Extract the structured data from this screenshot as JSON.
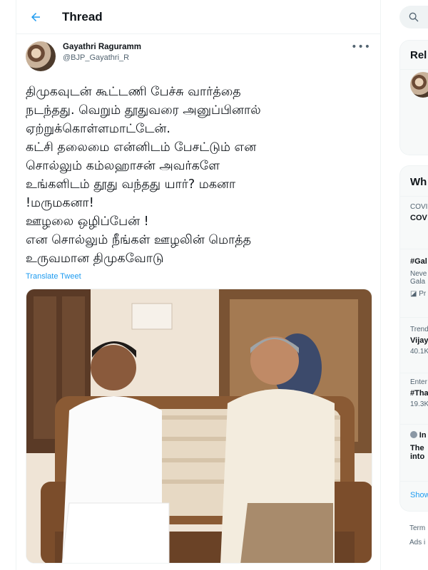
{
  "header": {
    "title": "Thread"
  },
  "tweet": {
    "author_name": "Gayathri Raguramm",
    "author_handle": "@BJP_Gayathri_R",
    "more_label": "•••",
    "text": "திமுகவுடன் கூட்டணி பேச்சு வார்த்தை\nநடந்தது. வெறும் தூதுவரை  அனுப்பினால்\nஏற்றுக்கொள்ளமாட்டேன்.\nகட்சி தலைமை என்னிடம் பேசட்டும்  என\nசொல்லும் கம்லஹாசன் அவர்களே\nஉங்களிடம் தூது வந்தது யார்? மகனா\n!மருமகனா!\n ஊழலை ஒழிப்பேன் !\nஎன சொல்லும் நீங்கள் ஊழலின் மொத்த\nஉருவமான திமுகவோடு",
    "translate_label": "Translate Tweet"
  },
  "sidebar": {
    "relevant_title": "Rel",
    "trends_title": "Wh",
    "trends": [
      {
        "category": "COVI",
        "title": "COV"
      },
      {
        "title": "#Gal",
        "line1": "Neve",
        "line2": "Gala",
        "promo": "Pr"
      },
      {
        "category": "Trend",
        "title": "Vijay",
        "count": "40.1K"
      },
      {
        "category": "Enter",
        "title": "#Tha",
        "count": "19.3K"
      },
      {
        "source": "In",
        "title": "The",
        "line1": "into"
      }
    ],
    "show_more": "Show",
    "footer_terms": "Term",
    "footer_ads": "Ads i"
  }
}
